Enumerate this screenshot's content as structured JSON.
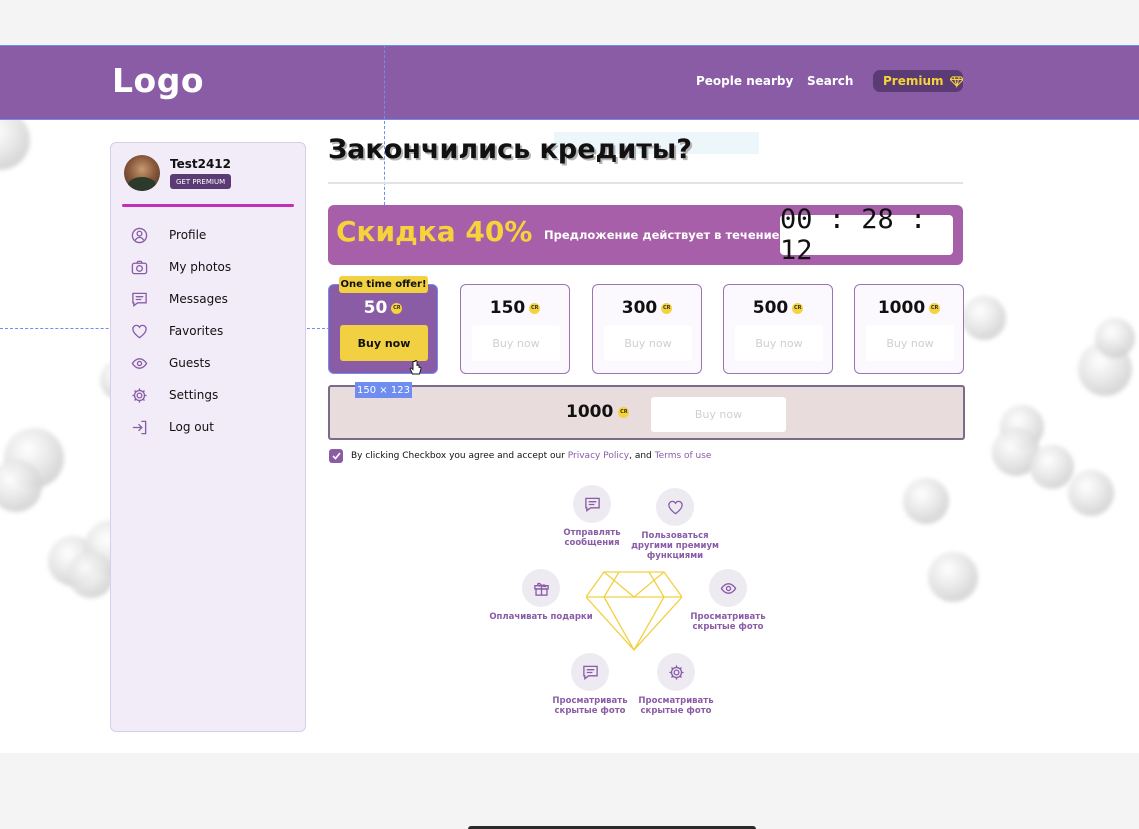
{
  "header": {
    "logo": "Logo",
    "nav": [
      "People nearby",
      "Search"
    ],
    "premium_label": "Premium"
  },
  "sidebar": {
    "username": "Test2412",
    "get_premium": "GET PREMIUM",
    "items": [
      {
        "label": "Profile",
        "icon": "user-circle-icon"
      },
      {
        "label": "My photos",
        "icon": "camera-icon"
      },
      {
        "label": "Messages",
        "icon": "message-icon"
      },
      {
        "label": "Favorites",
        "icon": "heart-icon"
      },
      {
        "label": "Guests",
        "icon": "eye-icon"
      },
      {
        "label": "Settings",
        "icon": "gear-icon"
      },
      {
        "label": "Log out",
        "icon": "logout-icon"
      }
    ]
  },
  "main": {
    "title": "Закончились кредиты?",
    "promo": {
      "discount": "Скидка 40%",
      "text": "Предложение действует в течение:",
      "timer": "00 : 28 : 12"
    },
    "one_time_offer": "One time offer!",
    "dimension_tag": "150 × 123",
    "coin_label": "CR",
    "offers": [
      {
        "amount": "50",
        "buy": "Buy now"
      },
      {
        "amount": "150",
        "buy": "Buy now"
      },
      {
        "amount": "300",
        "buy": "Buy now"
      },
      {
        "amount": "500",
        "buy": "Buy now"
      },
      {
        "amount": "1000",
        "buy": "Buy now"
      }
    ],
    "big_offer": {
      "amount": "1000",
      "buy": "Buy now"
    },
    "agreement": {
      "prefix": "By clicking Checkbox you agree and accept our",
      "privacy": "Privacy Policy",
      "middle": ", and",
      "terms": "Terms of use"
    },
    "features": [
      {
        "label": "Отправлять сообщения",
        "icon": "message-icon"
      },
      {
        "label": "Пользоваться другими премиум функциями",
        "icon": "heart-icon"
      },
      {
        "label": "Оплачивать подарки",
        "icon": "gift-icon"
      },
      {
        "label": "Просматривать скрытые фото",
        "icon": "eye-icon"
      },
      {
        "label": "Просматривать скрытые фото",
        "icon": "message-icon"
      },
      {
        "label": "Просматривать скрытые фото",
        "icon": "gear-icon"
      }
    ]
  },
  "colors": {
    "brand_purple": "#8a5ca6",
    "accent_yellow": "#f1d042",
    "dark_purple": "#5a3b74"
  }
}
